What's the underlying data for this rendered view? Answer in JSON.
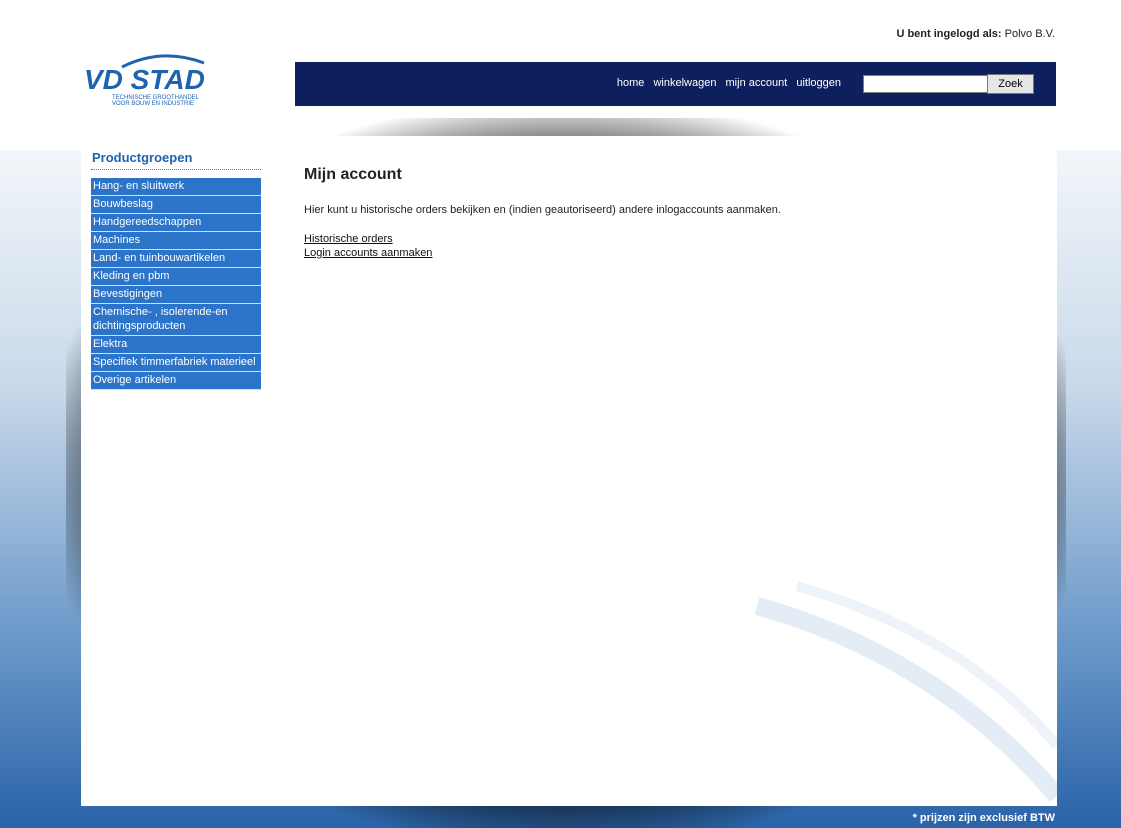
{
  "header": {
    "login_label": "U bent ingelogd als:",
    "login_user": "Polvo B.V.",
    "logo": {
      "name": "VD STAD",
      "line1": "TECHNISCHE GROOTHANDEL",
      "line2": "VOOR BOUW EN INDUSTRIE"
    }
  },
  "nav": {
    "links": [
      "home",
      "winkelwagen",
      "mijn account",
      "uitloggen"
    ],
    "search_value": "",
    "search_button": "Zoek"
  },
  "sidebar": {
    "title": "Productgroepen",
    "items": [
      "Hang- en sluitwerk",
      "Bouwbeslag",
      "Handgereedschappen",
      "Machines",
      "Land- en tuinbouwartikelen",
      "Kleding en pbm",
      "Bevestigingen",
      "Chemische- , isolerende-en dichtingsproducten",
      "Elektra",
      "Specifiek timmerfabriek materieel",
      "Overige artikelen"
    ]
  },
  "main": {
    "title": "Mijn account",
    "intro": "Hier kunt u historische orders bekijken en (indien geautoriseerd) andere inlogaccounts aanmaken.",
    "links": [
      "Historische orders",
      "Login accounts aanmaken"
    ]
  },
  "footer": {
    "note": "* prijzen zijn exclusief BTW"
  },
  "colors": {
    "navbar": "#0d1f5c",
    "sidebar_item": "#2b74c9",
    "sidebar_title": "#1e63b0"
  }
}
